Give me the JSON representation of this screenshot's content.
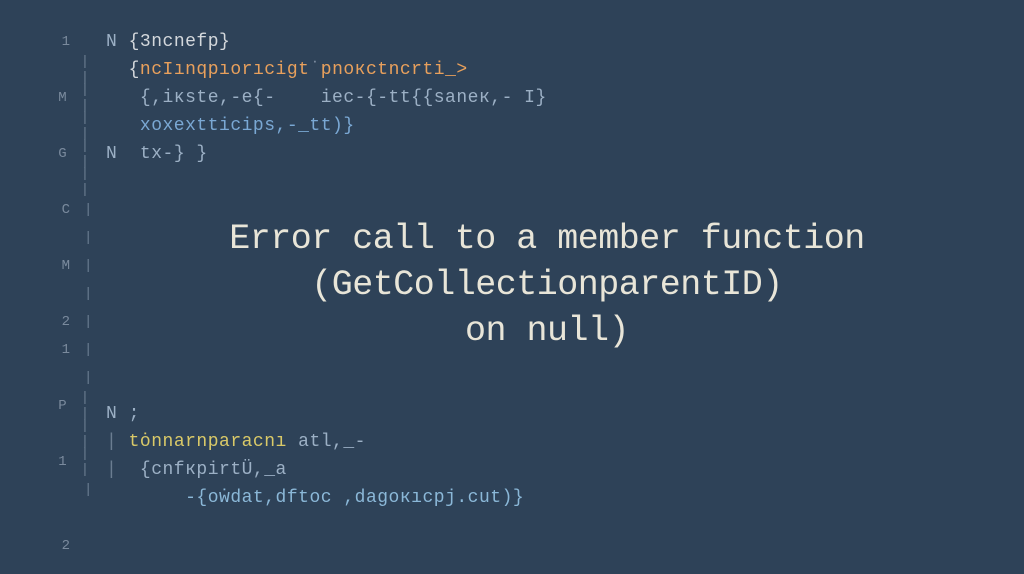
{
  "gutter": {
    "rows": [
      {
        "num": "1",
        "pipe": ""
      },
      {
        "num": "",
        "pipe": "| |"
      },
      {
        "num": "M",
        "pipe": "| |"
      },
      {
        "num": "",
        "pipe": "| |"
      },
      {
        "num": "G",
        "pipe": "| |"
      },
      {
        "num": "",
        "pipe": "| |"
      },
      {
        "num": "C",
        "pipe": "|"
      },
      {
        "num": "",
        "pipe": "|"
      },
      {
        "num": "M",
        "pipe": "|"
      },
      {
        "num": "",
        "pipe": "|"
      },
      {
        "num": "2",
        "pipe": "|"
      },
      {
        "num": "1",
        "pipe": "|"
      },
      {
        "num": "",
        "pipe": "|"
      },
      {
        "num": "P",
        "pipe": "| |"
      },
      {
        "num": "",
        "pipe": "| |"
      },
      {
        "num": "1",
        "pipe": "| |"
      },
      {
        "num": "",
        "pipe": "|"
      },
      {
        "num": "",
        "pipe": ""
      },
      {
        "num": "2",
        "pipe": ""
      }
    ]
  },
  "code": {
    "line1_n": "N",
    "line1_brace": "{3ncnefp}",
    "line2_open": "{",
    "line2_orange": "ncIınqpıorıcigt",
    "line2_orange2": "pnoкctncrti_>",
    "line3": "{,iĸste,-e{-    iec-{-tt{{saneк,- I}",
    "line4": "xoxextticips,-_tt)}",
    "line5_n": "N",
    "line5_txt": "tx-} }",
    "lower_line1_n": "N ;",
    "lower_line2_yellow": "tȯnnarnparacnı",
    "lower_line2_rest": " atl,_-",
    "lower_line3": "{cnfкpirtÜ,_a",
    "lower_line4": "-{oẇdat,dftoc ,dagoкıcpj.cut)}"
  },
  "error": {
    "line1": "Error call to a member function",
    "line2": "(GetCollectionparentID)",
    "line3": "on null)"
  }
}
